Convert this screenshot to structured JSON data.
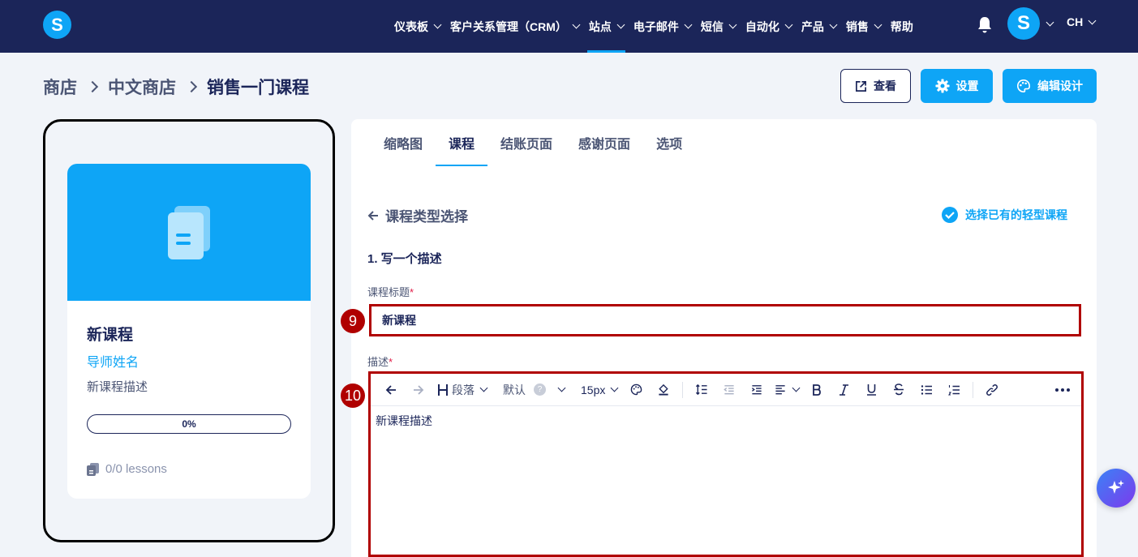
{
  "topbar": {
    "logo_letter": "S",
    "nav": [
      {
        "label": "仪表板",
        "has_dropdown": true
      },
      {
        "label": "客户关系管理（CRM）",
        "has_dropdown": true
      },
      {
        "label": "站点",
        "has_dropdown": true,
        "active": true
      },
      {
        "label": "电子邮件",
        "has_dropdown": true
      },
      {
        "label": "短信",
        "has_dropdown": true
      },
      {
        "label": "自动化",
        "has_dropdown": true
      },
      {
        "label": "产品",
        "has_dropdown": true
      },
      {
        "label": "销售",
        "has_dropdown": true
      },
      {
        "label": "帮助",
        "has_dropdown": false
      }
    ],
    "avatar_letter": "S",
    "language": "CH"
  },
  "breadcrumb": [
    "商店",
    "中文商店",
    "销售一门课程"
  ],
  "header_buttons": {
    "view": "查看",
    "settings": "设置",
    "edit_design": "编辑设计"
  },
  "preview": {
    "title": "新课程",
    "instructor": "导师姓名",
    "description": "新课程描述",
    "progress": "0%",
    "lessons": "0/0 lessons"
  },
  "tabs": [
    "缩略图",
    "课程",
    "结账页面",
    "感谢页面",
    "选项"
  ],
  "active_tab": "课程",
  "panel": {
    "back_label": "课程类型选择",
    "select_existing": "选择已有的轻型课程",
    "section_title": "1. 写一个描述",
    "title_label": "课程标题",
    "title_value": "新课程",
    "desc_label": "描述",
    "desc_value": "新课程描述",
    "required_mark": "*"
  },
  "editor_toolbar": {
    "paragraph": "段落",
    "font": "默认",
    "help_mark": "?",
    "size": "15px"
  },
  "annotations": {
    "title_badge": "9",
    "editor_badge": "10"
  },
  "colors": {
    "navy": "#1b2559",
    "accent": "#0ea5f6",
    "highlight": "#b00000",
    "background": "#f1f4f9"
  }
}
